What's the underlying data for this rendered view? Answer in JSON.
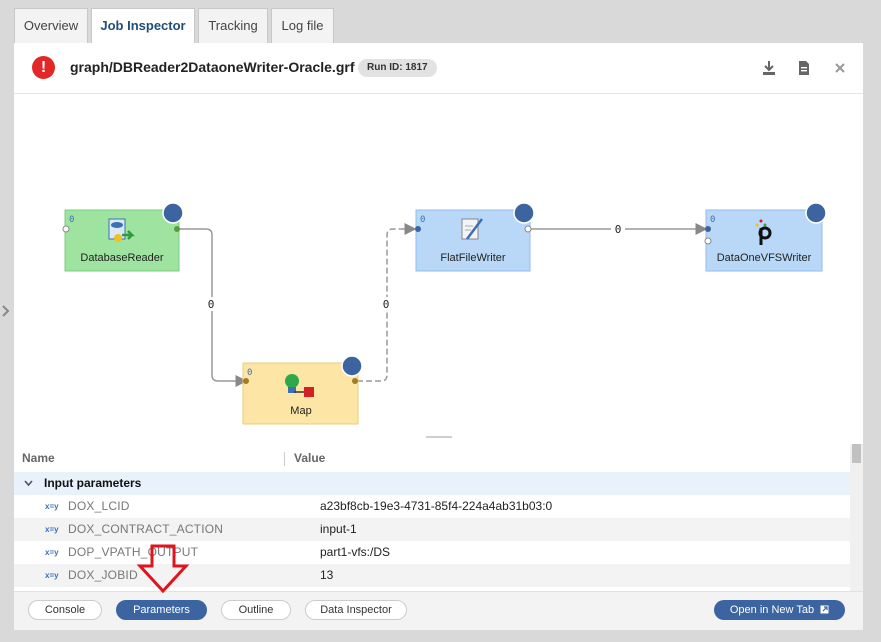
{
  "tabs": [
    {
      "label": "Overview",
      "active": false
    },
    {
      "label": "Job Inspector",
      "active": true
    },
    {
      "label": "Tracking",
      "active": false
    },
    {
      "label": "Log file",
      "active": false
    }
  ],
  "header": {
    "title": "graph/DBReader2DataoneWriter-Oracle.grf",
    "run_id": "Run ID: 1817",
    "status_icon": "error-icon",
    "status_color": "#e32726",
    "actions": [
      "download-icon",
      "document-icon",
      "close-icon"
    ]
  },
  "graph": {
    "nodes": [
      {
        "id": "database-reader",
        "label": "DatabaseReader",
        "phase": "0",
        "color": "#9ee4a0"
      },
      {
        "id": "map",
        "label": "Map",
        "phase": "0",
        "color": "#fde5a5"
      },
      {
        "id": "flat-file-writer",
        "label": "FlatFileWriter",
        "phase": "0",
        "color": "#b9d8f7"
      },
      {
        "id": "dataone-vfs-writer",
        "label": "DataOneVFSWriter",
        "phase": "0",
        "color": "#b9d8f7"
      }
    ],
    "edges": [
      {
        "from": "database-reader",
        "to": "map",
        "records": "0"
      },
      {
        "from": "map",
        "to": "flat-file-writer",
        "records": "0"
      },
      {
        "from": "flat-file-writer",
        "to": "dataone-vfs-writer",
        "records": "0"
      }
    ]
  },
  "table": {
    "columns": {
      "name": "Name",
      "value": "Value"
    },
    "group_label": "Input parameters",
    "rows": [
      {
        "name": "DOX_LCID",
        "value": "a23bf8cb-19e3-4731-85f4-224a4ab31b03:0"
      },
      {
        "name": "DOX_CONTRACT_ACTION",
        "value": "input-1"
      },
      {
        "name": "DOP_VPATH_OUTPUT",
        "value": "part1-vfs:/DS"
      },
      {
        "name": "DOX_JOBID",
        "value": "13"
      }
    ],
    "param_icon_label": "x=y"
  },
  "footer": {
    "buttons": [
      {
        "label": "Console",
        "active": false
      },
      {
        "label": "Parameters",
        "active": true
      },
      {
        "label": "Outline",
        "active": false
      },
      {
        "label": "Data Inspector",
        "active": false
      }
    ],
    "open_new_tab": "Open in New Tab"
  },
  "colors": {
    "accent": "#3c64a0",
    "arrow": "#e0141e"
  }
}
